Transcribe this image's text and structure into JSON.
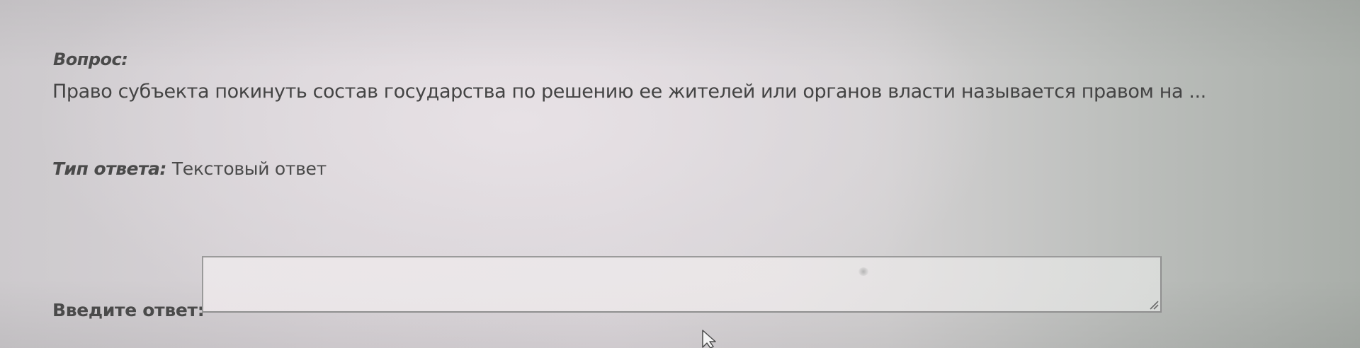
{
  "question": {
    "label": "Вопрос:",
    "text": "Право субъекта покинуть состав государства по решению ее жителей или органов власти называется правом на ..."
  },
  "answer_type": {
    "label": "Тип ответа:",
    "value": "Текстовый ответ"
  },
  "answer_input": {
    "label": "Введите ответ:",
    "value": ""
  },
  "icons": {
    "resize": "resize-grip-icon",
    "cursor": "mouse-pointer-icon"
  }
}
